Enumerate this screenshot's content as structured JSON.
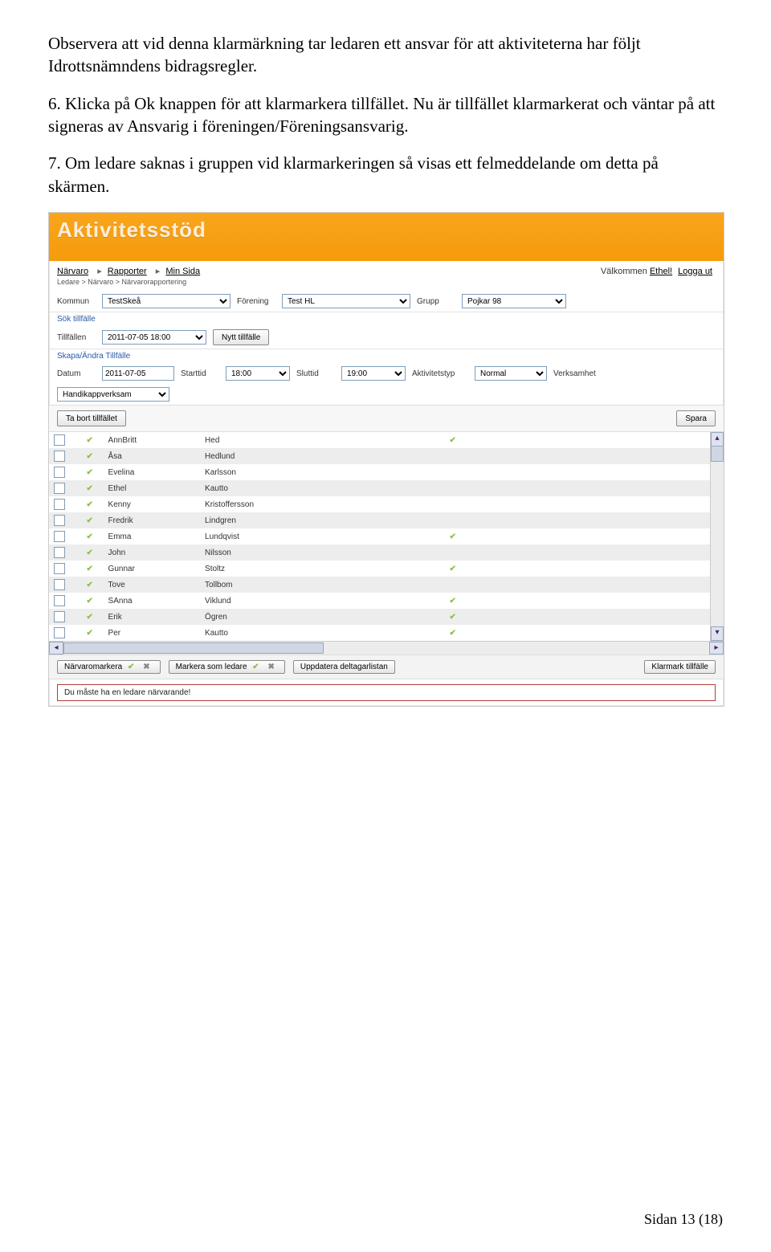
{
  "doc": {
    "p1": "Observera att vid denna klarmärkning tar ledaren ett ansvar för att aktiviteterna har följt Idrottsnämndens bidragsregler.",
    "p2": "6. Klicka på Ok knappen för att klarmarkera tillfället. Nu är tillfället klarmarkerat och väntar på att signeras av Ansvarig i föreningen/Föreningsansvarig.",
    "p3": "7. Om ledare saknas i gruppen vid klarmarkeringen så visas ett felmeddelande om detta på skärmen.",
    "footer": "Sidan 13 (18)"
  },
  "app": {
    "title": "Aktivitetsstöd",
    "nav": {
      "narvaro": "Närvaro",
      "rapporter": "Rapporter",
      "minsida": "Min Sida"
    },
    "welcome_label": "Välkommen",
    "welcome_user": "Ethel!",
    "logout": "Logga ut",
    "breadcrumb": "Ledare > Närvaro > Närvarorapportering",
    "selectors": {
      "kommun_lbl": "Kommun",
      "kommun_val": "TestSkeå",
      "forening_lbl": "Förening",
      "forening_val": "Test HL",
      "grupp_lbl": "Grupp",
      "grupp_val": "Pojkar 98"
    },
    "sok_section": "Sök tillfälle",
    "tillfallen_lbl": "Tillfällen",
    "tillfallen_val": "2011-07-05 18:00",
    "nytt_tillfalle_btn": "Nytt tillfälle",
    "skapa_section": "Skapa/Ändra Tillfälle",
    "form": {
      "datum_lbl": "Datum",
      "datum_val": "2011-07-05",
      "starttid_lbl": "Starttid",
      "starttid_val": "18:00",
      "sluttid_lbl": "Sluttid",
      "sluttid_val": "19:00",
      "aktivitetstyp_lbl": "Aktivitetstyp",
      "aktivitetstyp_val": "Normal",
      "verksamhet_lbl": "Verksamhet",
      "verksamhet_val": "Handikappverksam"
    },
    "tabort_btn": "Ta bort tillfället",
    "spara_btn": "Spara",
    "participants": [
      {
        "first": "AnnBritt",
        "last": "Hed",
        "tick1": true,
        "tick2": true
      },
      {
        "first": "Åsa",
        "last": "Hedlund",
        "tick1": true,
        "tick2": false
      },
      {
        "first": "Evelina",
        "last": "Karlsson",
        "tick1": true,
        "tick2": false
      },
      {
        "first": "Ethel",
        "last": "Kautto",
        "tick1": true,
        "tick2": false
      },
      {
        "first": "Kenny",
        "last": "Kristoffersson",
        "tick1": true,
        "tick2": false
      },
      {
        "first": "Fredrik",
        "last": "Lindgren",
        "tick1": true,
        "tick2": false
      },
      {
        "first": "Emma",
        "last": "Lundqvist",
        "tick1": true,
        "tick2": true
      },
      {
        "first": "John",
        "last": "Nilsson",
        "tick1": true,
        "tick2": false
      },
      {
        "first": "Gunnar",
        "last": "Stoltz",
        "tick1": true,
        "tick2": true
      },
      {
        "first": "Tove",
        "last": "Tollbom",
        "tick1": true,
        "tick2": false
      },
      {
        "first": "SAnna",
        "last": "Viklund",
        "tick1": true,
        "tick2": true
      },
      {
        "first": "Erik",
        "last": "Ögren",
        "tick1": true,
        "tick2": true
      },
      {
        "first": "Per",
        "last": "Kautto",
        "tick1": true,
        "tick2": true
      }
    ],
    "buttons": {
      "narvaromarkera": "Närvaromarkera",
      "markera_ledare": "Markera som ledare",
      "uppdatera": "Uppdatera deltagarlistan",
      "klarmark": "Klarmark tillfälle"
    },
    "error": "Du måste ha en ledare närvarande!"
  }
}
